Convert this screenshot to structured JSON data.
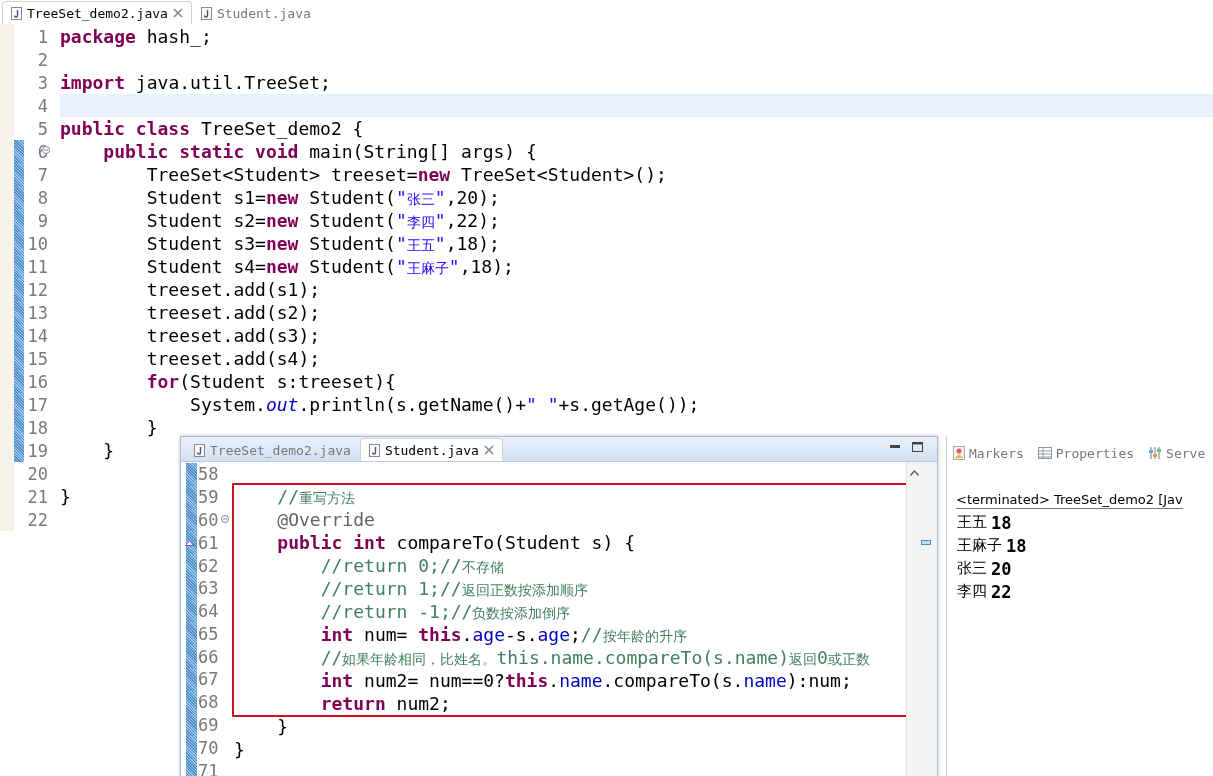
{
  "editor": {
    "tabs": [
      {
        "label": "TreeSet_demo2.java",
        "selected": true
      },
      {
        "label": "Student.java",
        "selected": false
      }
    ],
    "lines": [
      {
        "number": "1",
        "changed": false,
        "current": false,
        "foldable": false,
        "tokens": [
          {
            "kind": "kw",
            "text": "package"
          },
          {
            "kind": "plain",
            "text": " hash_;"
          }
        ]
      },
      {
        "number": "2",
        "changed": false,
        "current": false,
        "foldable": false
      },
      {
        "number": "3",
        "changed": false,
        "current": false,
        "foldable": false,
        "tokens": [
          {
            "kind": "kw",
            "text": "import"
          },
          {
            "kind": "plain",
            "text": " java.util.TreeSet;"
          }
        ]
      },
      {
        "number": "4",
        "changed": false,
        "current": true,
        "foldable": false
      },
      {
        "number": "5",
        "changed": false,
        "current": false,
        "foldable": false,
        "tokens": [
          {
            "kind": "kw",
            "text": "public class"
          },
          {
            "kind": "plain",
            "text": " TreeSet_demo2 {"
          }
        ]
      },
      {
        "number": "6",
        "changed": true,
        "current": false,
        "foldable": true,
        "tokens": [
          {
            "kind": "kw",
            "text": "    public static void"
          },
          {
            "kind": "plain",
            "text": " main(String[] args) {"
          }
        ]
      },
      {
        "number": "7",
        "changed": true,
        "current": false,
        "foldable": false,
        "tokens": [
          {
            "kind": "plain",
            "text": "        TreeSet<Student> treeset="
          },
          {
            "kind": "kw",
            "text": "new"
          },
          {
            "kind": "plain",
            "text": " TreeSet<Student>();"
          }
        ]
      },
      {
        "number": "8",
        "changed": true,
        "current": false,
        "foldable": false,
        "tokens": [
          {
            "kind": "plain",
            "text": "        Student s1="
          },
          {
            "kind": "kw",
            "text": "new"
          },
          {
            "kind": "plain",
            "text": " Student("
          },
          {
            "kind": "str",
            "text": "\""
          },
          {
            "kind": "str_cn",
            "text": "张三"
          },
          {
            "kind": "str",
            "text": "\""
          },
          {
            "kind": "plain",
            "text": ",20);"
          }
        ]
      },
      {
        "number": "9",
        "changed": true,
        "current": false,
        "foldable": false,
        "tokens": [
          {
            "kind": "plain",
            "text": "        Student s2="
          },
          {
            "kind": "kw",
            "text": "new"
          },
          {
            "kind": "plain",
            "text": " Student("
          },
          {
            "kind": "str",
            "text": "\""
          },
          {
            "kind": "str_cn",
            "text": "李四"
          },
          {
            "kind": "str",
            "text": "\""
          },
          {
            "kind": "plain",
            "text": ",22);"
          }
        ]
      },
      {
        "number": "10",
        "changed": true,
        "current": false,
        "foldable": false,
        "tokens": [
          {
            "kind": "plain",
            "text": "        Student s3="
          },
          {
            "kind": "kw",
            "text": "new"
          },
          {
            "kind": "plain",
            "text": " Student("
          },
          {
            "kind": "str",
            "text": "\""
          },
          {
            "kind": "str_cn",
            "text": "王五"
          },
          {
            "kind": "str",
            "text": "\""
          },
          {
            "kind": "plain",
            "text": ",18);"
          }
        ]
      },
      {
        "number": "11",
        "changed": true,
        "current": false,
        "foldable": false,
        "tokens": [
          {
            "kind": "plain",
            "text": "        Student s4="
          },
          {
            "kind": "kw",
            "text": "new"
          },
          {
            "kind": "plain",
            "text": " Student("
          },
          {
            "kind": "str",
            "text": "\""
          },
          {
            "kind": "str_cn",
            "text": "王麻子"
          },
          {
            "kind": "str",
            "text": "\""
          },
          {
            "kind": "plain",
            "text": ",18);"
          }
        ]
      },
      {
        "number": "12",
        "changed": true,
        "current": false,
        "foldable": false,
        "tokens": [
          {
            "kind": "plain",
            "text": "        treeset.add(s1);"
          }
        ]
      },
      {
        "number": "13",
        "changed": true,
        "current": false,
        "foldable": false,
        "tokens": [
          {
            "kind": "plain",
            "text": "        treeset.add(s2);"
          }
        ]
      },
      {
        "number": "14",
        "changed": true,
        "current": false,
        "foldable": false,
        "tokens": [
          {
            "kind": "plain",
            "text": "        treeset.add(s3);"
          }
        ]
      },
      {
        "number": "15",
        "changed": true,
        "current": false,
        "foldable": false,
        "tokens": [
          {
            "kind": "plain",
            "text": "        treeset.add(s4);"
          }
        ]
      },
      {
        "number": "16",
        "changed": true,
        "current": false,
        "foldable": false,
        "tokens": [
          {
            "kind": "kw",
            "text": "        for"
          },
          {
            "kind": "plain",
            "text": "(Student s:treeset){"
          }
        ]
      },
      {
        "number": "17",
        "changed": true,
        "current": false,
        "foldable": false,
        "tokens": [
          {
            "kind": "plain",
            "text": "            System."
          },
          {
            "kind": "static",
            "text": "out"
          },
          {
            "kind": "plain",
            "text": ".println(s.getName()+"
          },
          {
            "kind": "str",
            "text": "\" \""
          },
          {
            "kind": "plain",
            "text": "+s.getAge());"
          }
        ]
      },
      {
        "number": "18",
        "changed": true,
        "current": false,
        "foldable": false,
        "tokens": [
          {
            "kind": "plain",
            "text": "        }"
          }
        ]
      },
      {
        "number": "19",
        "changed": true,
        "current": false,
        "foldable": false,
        "tokens": [
          {
            "kind": "plain",
            "text": "    }"
          }
        ]
      },
      {
        "number": "20",
        "changed": false,
        "current": false,
        "foldable": false
      },
      {
        "number": "21",
        "changed": false,
        "current": false,
        "foldable": false,
        "tokens": [
          {
            "kind": "plain",
            "text": "}"
          }
        ]
      },
      {
        "number": "22",
        "changed": false,
        "current": false,
        "foldable": false
      }
    ]
  },
  "popup_editor": {
    "tabs": [
      {
        "label": "TreeSet_demo2.java",
        "selected": false
      },
      {
        "label": "Student.java",
        "selected": true
      }
    ],
    "lines": [
      {
        "kind": "line",
        "number": "58",
        "foldable": false,
        "override": false
      },
      {
        "kind": "highlight_box",
        "lines": [
          {
            "number": "59",
            "foldable": false,
            "override": false,
            "tokens": [
              {
                "kind": "com",
                "text": "    //"
              },
              {
                "kind": "com_cn",
                "text": "重写方法"
              }
            ]
          },
          {
            "number": "60",
            "foldable": true,
            "override": false,
            "tokens": [
              {
                "kind": "ann",
                "text": "    @Override"
              }
            ]
          },
          {
            "number": "61",
            "foldable": false,
            "override": true,
            "tokens": [
              {
                "kind": "kw",
                "text": "    public int"
              },
              {
                "kind": "plain",
                "text": " compareTo(Student s) {"
              }
            ]
          },
          {
            "number": "62",
            "foldable": false,
            "override": false,
            "tokens": [
              {
                "kind": "com",
                "text": "        //return 0;//"
              },
              {
                "kind": "com_cn",
                "text": "不存储"
              }
            ]
          },
          {
            "number": "63",
            "foldable": false,
            "override": false,
            "tokens": [
              {
                "kind": "com",
                "text": "        //return 1;//"
              },
              {
                "kind": "com_cn",
                "text": "返回正数按添加顺序"
              }
            ]
          },
          {
            "number": "64",
            "foldable": false,
            "override": false,
            "tokens": [
              {
                "kind": "com",
                "text": "        //return -1;//"
              },
              {
                "kind": "com_cn",
                "text": "负数按添加倒序"
              }
            ]
          },
          {
            "number": "65",
            "foldable": false,
            "override": false,
            "tokens": [
              {
                "kind": "kw",
                "text": "        int"
              },
              {
                "kind": "plain",
                "text": " num= "
              },
              {
                "kind": "kw",
                "text": "this"
              },
              {
                "kind": "plain",
                "text": "."
              },
              {
                "kind": "field",
                "text": "age"
              },
              {
                "kind": "plain",
                "text": "-s."
              },
              {
                "kind": "field",
                "text": "age"
              },
              {
                "kind": "plain",
                "text": ";"
              },
              {
                "kind": "com",
                "text": "//"
              },
              {
                "kind": "com_cn",
                "text": "按年龄的升序"
              }
            ]
          },
          {
            "number": "66",
            "foldable": false,
            "override": false,
            "tokens": [
              {
                "kind": "com",
                "text": "        //"
              },
              {
                "kind": "com_cn",
                "text": "如果年龄相同，比姓名。"
              },
              {
                "kind": "com",
                "text": "this.name.compareTo(s.name)"
              },
              {
                "kind": "com_cn",
                "text": "返回"
              },
              {
                "kind": "com",
                "text": "0"
              },
              {
                "kind": "com_cn",
                "text": "或正数"
              }
            ]
          },
          {
            "number": "67",
            "foldable": false,
            "override": false,
            "tokens": [
              {
                "kind": "kw",
                "text": "        int"
              },
              {
                "kind": "plain",
                "text": " num2= num==0?"
              },
              {
                "kind": "kw",
                "text": "this"
              },
              {
                "kind": "plain",
                "text": "."
              },
              {
                "kind": "field",
                "text": "name"
              },
              {
                "kind": "plain",
                "text": ".compareTo(s."
              },
              {
                "kind": "field",
                "text": "name"
              },
              {
                "kind": "plain",
                "text": "):num;"
              }
            ]
          },
          {
            "number": "68",
            "foldable": false,
            "override": false,
            "tokens": [
              {
                "kind": "kw",
                "text": "        return"
              },
              {
                "kind": "plain",
                "text": " num2;"
              }
            ]
          }
        ]
      },
      {
        "kind": "line",
        "number": "69",
        "foldable": false,
        "override": false,
        "tokens": [
          {
            "kind": "plain",
            "text": "    }"
          }
        ]
      },
      {
        "kind": "line",
        "number": "70",
        "foldable": false,
        "override": false,
        "tokens": [
          {
            "kind": "plain",
            "text": "}"
          }
        ]
      },
      {
        "kind": "line",
        "number": "71",
        "foldable": false,
        "override": false
      }
    ]
  },
  "console": {
    "tabs": [
      {
        "label": "Markers",
        "kind": "markers"
      },
      {
        "label": "Properties",
        "kind": "properties"
      },
      {
        "label": "Serve",
        "kind": "servers"
      }
    ],
    "header": "<terminated> TreeSet_demo2 [Jav",
    "output": [
      {
        "name": "王五",
        "value": "18"
      },
      {
        "name": "王麻子",
        "value": "18"
      },
      {
        "name": "张三",
        "value": "20"
      },
      {
        "name": "李四",
        "value": "22"
      }
    ]
  }
}
